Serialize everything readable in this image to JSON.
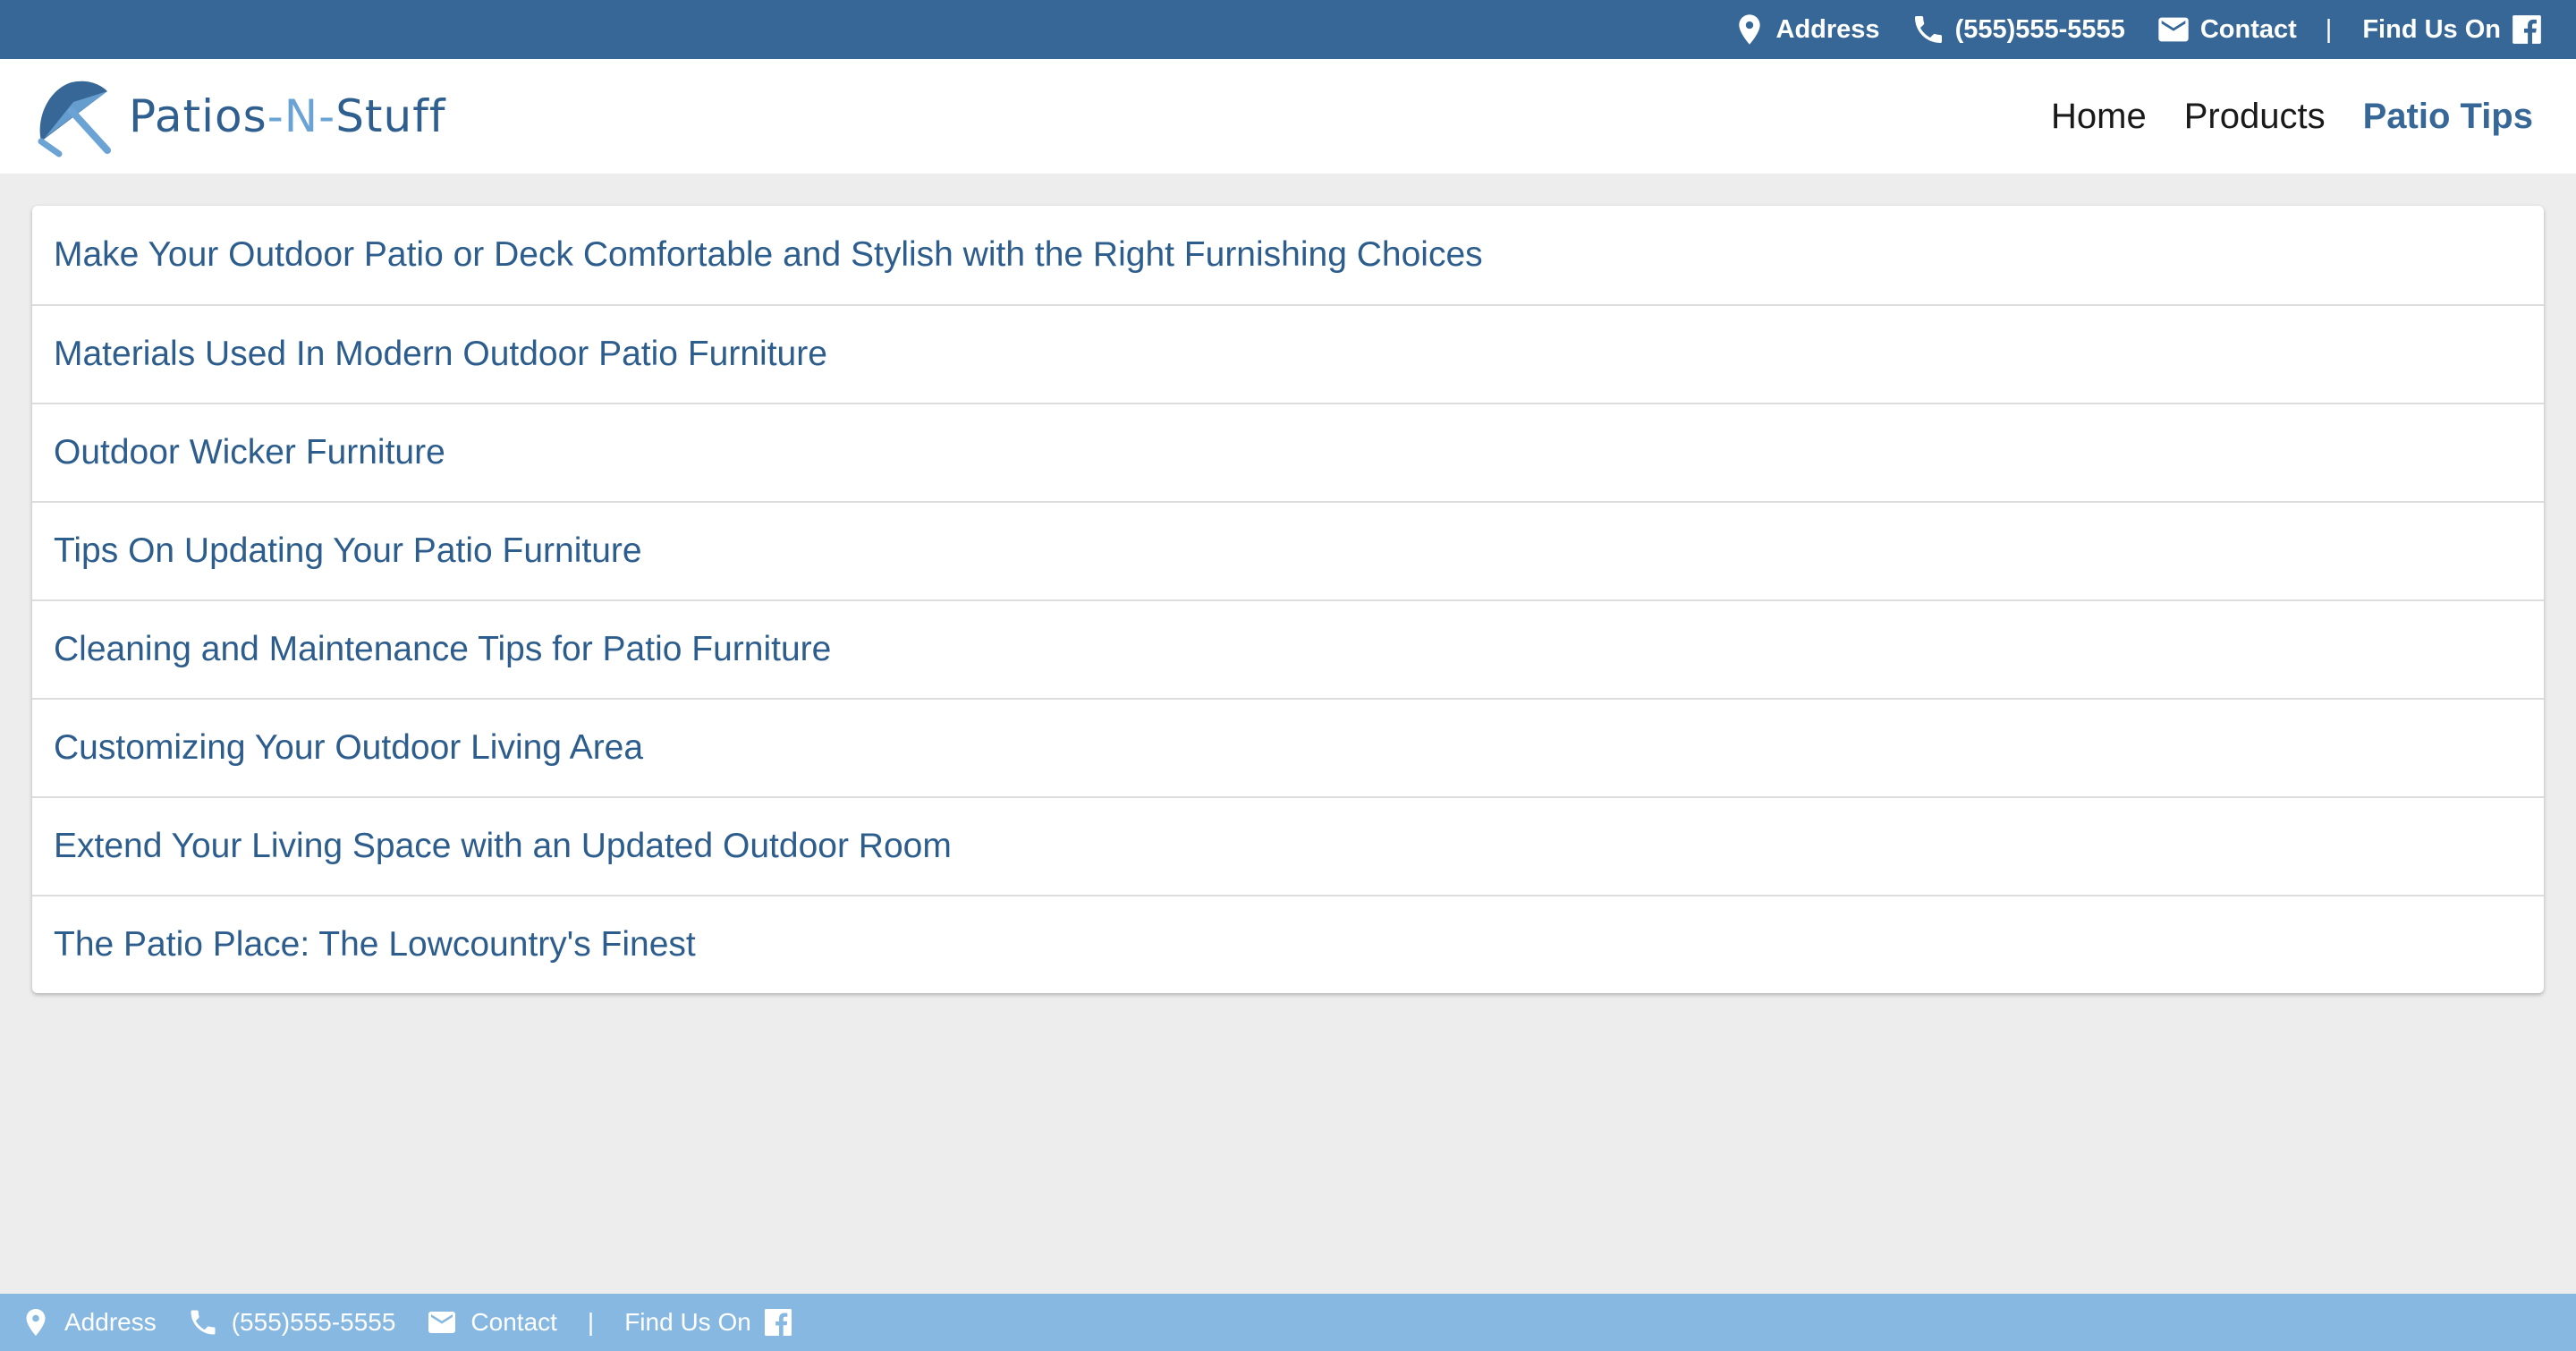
{
  "topbar": {
    "address_label": "Address",
    "phone": "(555)555-5555",
    "contact_label": "Contact",
    "separator": "|",
    "find_us_label": "Find Us On",
    "icons": [
      "location-pin-icon",
      "phone-icon",
      "mail-icon",
      "facebook-icon"
    ],
    "background_color": "#366797"
  },
  "header": {
    "brand": {
      "name_part1": "Patios",
      "name_part2": "-N-",
      "name_part3": "Stuff",
      "logo_icon": "umbrella-logo-icon"
    },
    "nav": [
      {
        "label": "Home",
        "active": false
      },
      {
        "label": "Products",
        "active": false
      },
      {
        "label": "Patio Tips",
        "active": true
      }
    ]
  },
  "articles": [
    {
      "title": "Make Your Outdoor Patio or Deck Comfortable and Stylish with the Right Furnishing Choices"
    },
    {
      "title": "Materials Used In Modern Outdoor Patio Furniture"
    },
    {
      "title": "Outdoor Wicker Furniture"
    },
    {
      "title": "Tips On Updating Your Patio Furniture"
    },
    {
      "title": "Cleaning and Maintenance Tips for Patio Furniture"
    },
    {
      "title": "Customizing Your Outdoor Living Area"
    },
    {
      "title": "Extend Your Living Space with an Updated Outdoor Room"
    },
    {
      "title": "The Patio Place: The Lowcountry's Finest"
    }
  ],
  "bottombar": {
    "address_label": "Address",
    "phone": "(555)555-5555",
    "contact_label": "Contact",
    "separator": "|",
    "find_us_label": "Find Us On",
    "background_color": "#86b8e2"
  }
}
